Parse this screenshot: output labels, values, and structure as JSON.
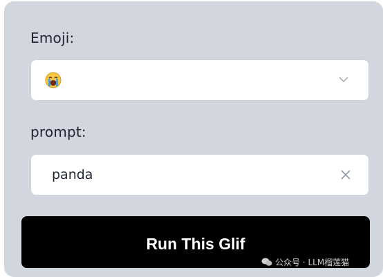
{
  "form": {
    "emoji_label": "Emoji:",
    "emoji_value": "crying-face emoji",
    "prompt_label": "prompt:",
    "prompt_value": "panda",
    "run_button_label": "Run This Glif"
  },
  "watermark": {
    "text": "公众号 · LLM榴莲猫"
  },
  "icons": {
    "emoji": "loudly-crying-face-icon",
    "select": "chevron-down-icon",
    "clear": "close-icon",
    "watermark": "wechat-icon"
  },
  "colors": {
    "panel_bg": "#d2d6de",
    "button_bg": "#000000",
    "button_text": "#ffffff",
    "emoji_face": "#f6c744",
    "tears": "#3aa0e8"
  }
}
